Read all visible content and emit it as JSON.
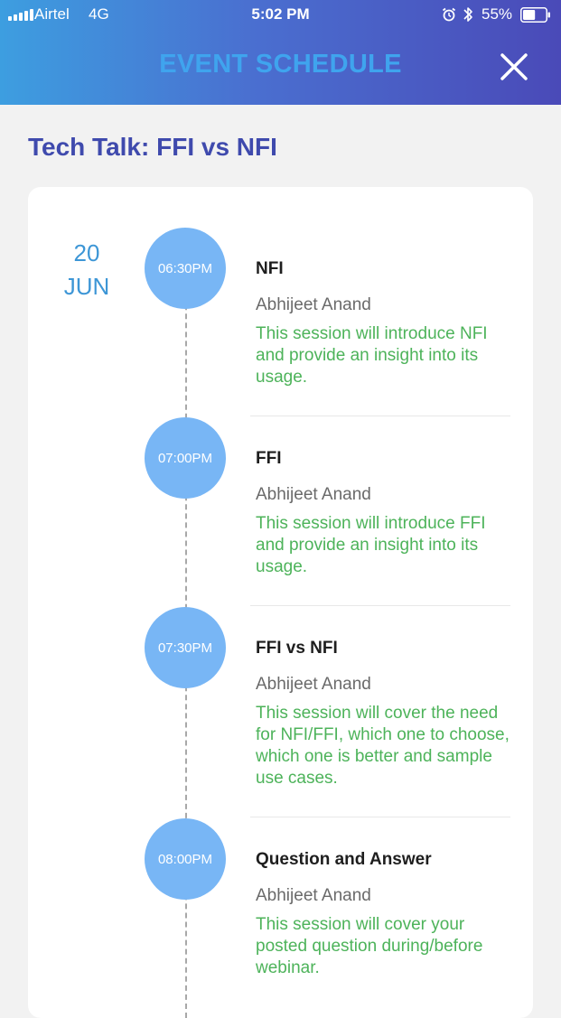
{
  "status_bar": {
    "carrier": "Airtel",
    "network": "4G",
    "time": "5:02 PM",
    "battery": "55%",
    "battery_level": 0.55
  },
  "header": {
    "title": "EVENT SCHEDULE",
    "close_icon": "close-icon"
  },
  "event": {
    "title": "Tech Talk: FFI vs NFI",
    "date_day": "20",
    "date_month": "JUN"
  },
  "sessions": [
    {
      "time": "06:30PM",
      "name": "NFI",
      "speaker": "Abhijeet Anand",
      "description": "This session will introduce NFI and provide an insight into its usage."
    },
    {
      "time": "07:00PM",
      "name": "FFI",
      "speaker": "Abhijeet Anand",
      "description": "This session will introduce FFI and provide an insight into its usage."
    },
    {
      "time": "07:30PM",
      "name": "FFI vs NFI",
      "speaker": "Abhijeet Anand",
      "description": "This session will cover the need for NFI/FFI, which one to choose, which one is better and sample use cases."
    },
    {
      "time": "08:00PM",
      "name": "Question and Answer",
      "speaker": "Abhijeet Anand",
      "description": "This session will cover your posted question during/before webinar."
    }
  ],
  "colors": {
    "title": "#3fa4ee",
    "event_title": "#3f4aad",
    "date": "#3d96d6",
    "time_circle": "#78b6f5",
    "description": "#4db35a",
    "speaker": "#6a6a6a"
  }
}
